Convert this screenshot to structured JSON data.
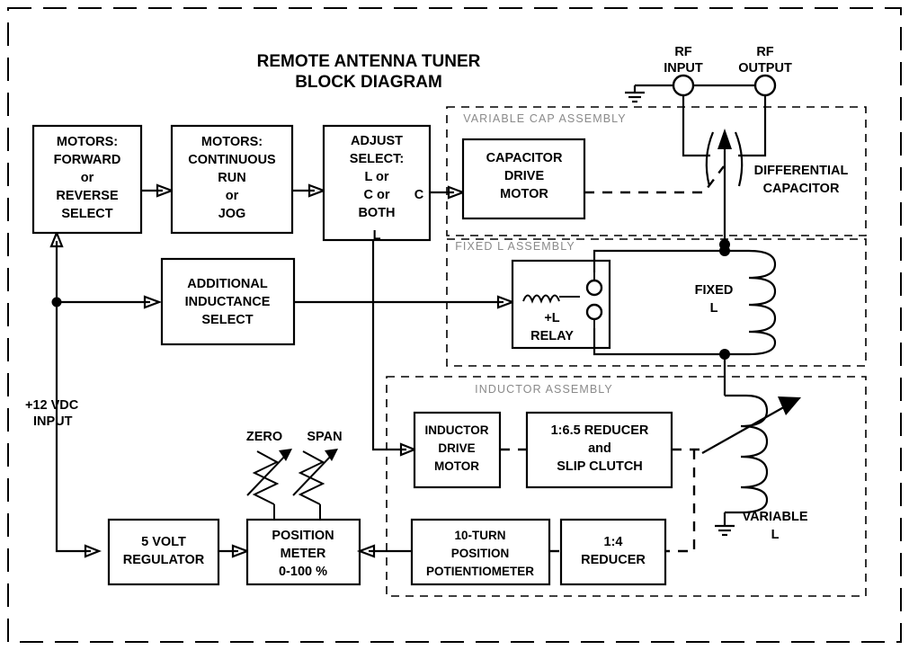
{
  "title": {
    "line1": "REMOTE ANTENNA TUNER",
    "line2": "BLOCK DIAGRAM"
  },
  "blocks": {
    "motors_select": [
      "MOTORS:",
      "FORWARD",
      "or",
      "REVERSE",
      "SELECT"
    ],
    "motors_run": [
      "MOTORS:",
      "CONTINUOUS",
      "RUN",
      "or",
      "JOG"
    ],
    "adjust_select": [
      "ADJUST",
      "SELECT:",
      "L or",
      "C or",
      "BOTH"
    ],
    "additional_inductance": [
      "ADDITIONAL",
      "INDUCTANCE",
      "SELECT"
    ],
    "capacitor_drive_motor": [
      "CAPACITOR",
      "DRIVE",
      "MOTOR"
    ],
    "plus_l_relay": [
      "+L",
      "RELAY"
    ],
    "inductor_drive_motor": [
      "INDUCTOR",
      "DRIVE",
      "MOTOR"
    ],
    "reducer_clutch": [
      "1:6.5 REDUCER",
      "and",
      "SLIP CLUTCH"
    ],
    "voltage_regulator": [
      "5 VOLT",
      "REGULATOR"
    ],
    "position_meter": [
      "POSITION",
      "METER",
      "0-100 %"
    ],
    "potentiometer": [
      "10-TURN",
      "POSITION",
      "POTIENTIOMETER"
    ],
    "reducer_1_4": [
      "1:4",
      "REDUCER"
    ]
  },
  "assemblies": {
    "variable_cap": "VARIABLE CAP ASSEMBLY",
    "fixed_l": "FIXED L ASSEMBLY",
    "inductor": "INDUCTOR ASSEMBLY"
  },
  "labels": {
    "rf_input": [
      "RF",
      "INPUT"
    ],
    "rf_output": [
      "RF",
      "OUTPUT"
    ],
    "differential_capacitor": [
      "DIFFERENTIAL",
      "CAPACITOR"
    ],
    "fixed_l": [
      "FIXED",
      "L"
    ],
    "variable_l": [
      "VARIABLE",
      "L"
    ],
    "power_input": [
      "+12 VDC",
      "INPUT"
    ],
    "zero": "ZERO",
    "span": "SPAN",
    "adjust_out_c": "C",
    "adjust_out_l": "L"
  },
  "colors": {
    "line": "#000000",
    "assembly_label": "#8a8a8a",
    "background": "#ffffff"
  },
  "icons": {
    "ground": "ground-symbol",
    "differential_capacitor": "differential-capacitor-symbol",
    "inductor_fixed": "inductor-coil-symbol",
    "inductor_variable": "variable-inductor-symbol",
    "relay_coil": "relay-coil-symbol",
    "relay_contacts": "relay-contact-symbol",
    "trimpot_zero": "variable-resistor-symbol",
    "trimpot_span": "variable-resistor-symbol"
  }
}
